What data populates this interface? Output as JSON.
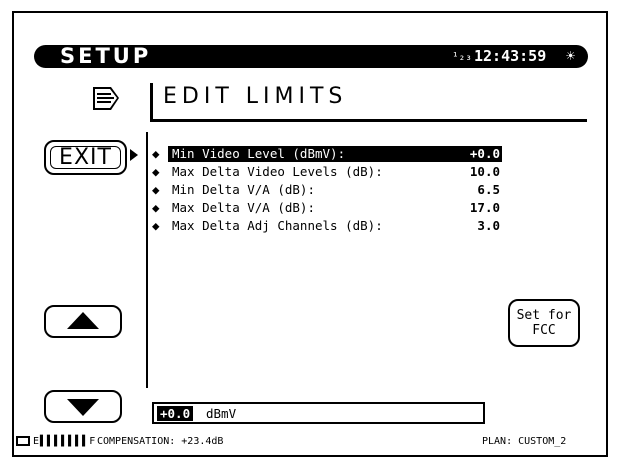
{
  "header": {
    "title": "SETUP",
    "indicator": "¹₂₃",
    "time": "12:43:59",
    "sun_icon": "sun-icon"
  },
  "subtitle": "EDIT LIMITS",
  "buttons": {
    "exit": "EXIT",
    "up_icon": "up-arrow-icon",
    "down_icon": "down-arrow-icon",
    "fcc_line1": "Set for",
    "fcc_line2": "FCC"
  },
  "limits": [
    {
      "label": "Min Video Level (dBmV):",
      "value": "+0.0",
      "selected": true
    },
    {
      "label": "Max Delta Video Levels (dB):",
      "value": "10.0",
      "selected": false
    },
    {
      "label": "Min Delta V/A (dB):",
      "value": "6.5",
      "selected": false
    },
    {
      "label": "Max Delta V/A (dB):",
      "value": "17.0",
      "selected": false
    },
    {
      "label": "Max Delta Adj Channels (dB):",
      "value": "3.0",
      "selected": false
    }
  ],
  "entry": {
    "value": "+0.0",
    "unit": "dBmV"
  },
  "status": {
    "battery": "E",
    "battery_end": "F",
    "compensation": "COMPENSATION: +23.4dB",
    "plan": "PLAN: CUSTOM_2"
  }
}
